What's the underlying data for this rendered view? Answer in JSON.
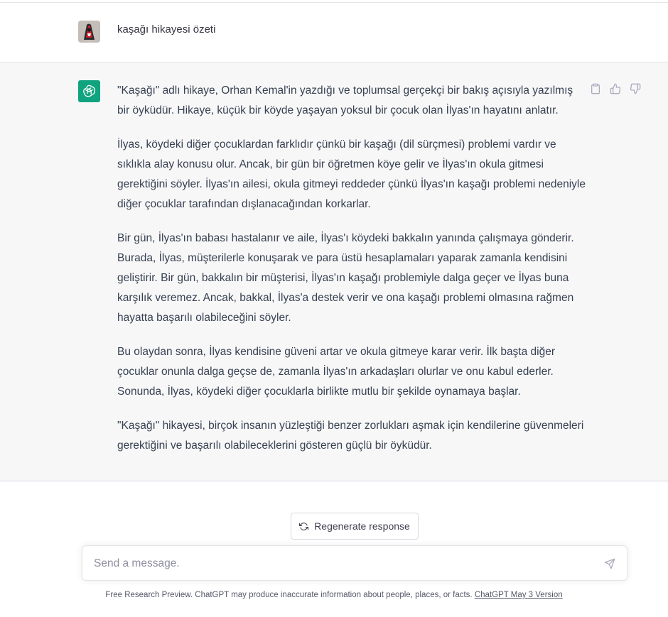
{
  "user_message": {
    "text": "kaşağı hikayesi özeti"
  },
  "assistant_message": {
    "paragraphs": [
      "\"Kaşağı\" adlı hikaye, Orhan Kemal'in yazdığı ve toplumsal gerçekçi bir bakış açısıyla yazılmış bir öyküdür. Hikaye, küçük bir köyde yaşayan yoksul bir çocuk olan İlyas'ın hayatını anlatır.",
      "İlyas, köydeki diğer çocuklardan farklıdır çünkü bir kaşağı (dil sürçmesi) problemi vardır ve sıklıkla alay konusu olur. Ancak, bir gün bir öğretmen köye gelir ve İlyas'ın okula gitmesi gerektiğini söyler. İlyas'ın ailesi, okula gitmeyi reddeder çünkü İlyas'ın kaşağı problemi nedeniyle diğer çocuklar tarafından dışlanacağından korkarlar.",
      "Bir gün, İlyas'ın babası hastalanır ve aile, İlyas'ı köydeki bakkalın yanında çalışmaya gönderir. Burada, İlyas, müşterilerle konuşarak ve para üstü hesaplamaları yaparak zamanla kendisini geliştirir. Bir gün, bakkalın bir müşterisi, İlyas'ın kaşağı problemiyle dalga geçer ve İlyas buna karşılık veremez. Ancak, bakkal, İlyas'a destek verir ve ona kaşağı problemi olmasına rağmen hayatta başarılı olabileceğini söyler.",
      "Bu olaydan sonra, İlyas kendisine güveni artar ve okula gitmeye karar verir. İlk başta diğer çocuklar onunla dalga geçse de, zamanla İlyas'ın arkadaşları olurlar ve onu kabul ederler. Sonunda, İlyas, köydeki diğer çocuklarla birlikte mutlu bir şekilde oynamaya başlar.",
      "\"Kaşağı\" hikayesi, birçok insanın yüzleştiği benzer zorlukları aşmak için kendilerine güvenmeleri gerektiğini ve başarılı olabileceklerini gösteren güçlü bir öyküdür."
    ]
  },
  "actions": {
    "copy_icon": "clipboard-icon",
    "like_icon": "thumbs-up-icon",
    "dislike_icon": "thumbs-down-icon"
  },
  "regenerate": {
    "label": "Regenerate response",
    "icon": "refresh-icon"
  },
  "composer": {
    "placeholder": "Send a message.",
    "value": "",
    "send_icon": "send-icon"
  },
  "footer": {
    "text": "Free Research Preview. ChatGPT may produce inaccurate information about people, places, or facts. ",
    "link_text": "ChatGPT May 3 Version"
  },
  "colors": {
    "brand": "#10a37f",
    "assistant_bg": "#f7f7f8",
    "text": "#374151"
  }
}
